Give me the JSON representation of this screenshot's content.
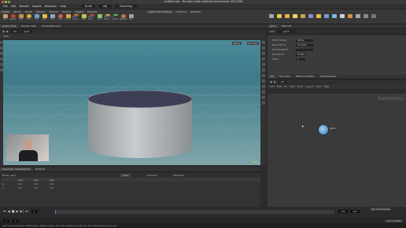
{
  "window": {
    "title": "untitled.hip - Houdini Indie Limited-Commercial 16.5.496"
  },
  "menu": {
    "items": [
      "File",
      "Edit",
      "Render",
      "Assets",
      "Windows",
      "Help"
    ],
    "build_label": "Build",
    "desktop_label": "Modeling",
    "path_label": "obj"
  },
  "shelf": {
    "tabs": [
      "Create",
      "Modify",
      "Model",
      "Polygon",
      "Deform",
      "Texture",
      "Rigging",
      "Muscles"
    ],
    "right_tabs": [
      "Lights and Cameras",
      "Collisions",
      "Particles"
    ],
    "tools": [
      "Box",
      "Sphere",
      "Tube",
      "Torus",
      "Grid",
      "Null",
      "Line",
      "Circle",
      "Curve",
      "Draw Curve",
      "Path",
      "Spray Paint",
      "Font",
      "Platonic Solids",
      "L-System",
      "Metaball",
      "File"
    ]
  },
  "scene_view": {
    "tabs": [
      "Scene View",
      "Render View",
      "Composite View"
    ],
    "path": "obj",
    "node": "geo1",
    "persp_label": "Persp",
    "cam_label": "No cam",
    "hud_label": "Geo"
  },
  "params": {
    "tabs": [
      "geo1",
      "Take List"
    ],
    "node_type": "Geo",
    "node_name": "geo1",
    "fields": [
      {
        "label": "Xform Order",
        "value": "Rotate"
      },
      {
        "label": "Pivot Xform",
        "value": "Translate"
      },
      {
        "label": "Pre-transform",
        "value": ""
      },
      {
        "label": "Transform",
        "value": "Enable"
      },
      {
        "label": "Scale",
        "value": "1"
      }
    ]
  },
  "network": {
    "tabs": [
      "obj",
      "Tree View",
      "Material Palette",
      "Asset Browser"
    ],
    "path": "obj",
    "menu": [
      "Add",
      "Edit",
      "Go",
      "View",
      "Tools",
      "Layout",
      "Labs",
      "Help"
    ],
    "context_label": "Geometry",
    "node_label": "geo1"
  },
  "bottom": {
    "tabs": [
      "Geometry Spreadsheet",
      "Textport"
    ],
    "node_label": "Node: geo1",
    "view_label": "View",
    "intrinsics_label": "Intrinsics",
    "attributes_label": "Attributes",
    "columns": [
      "",
      "P[x]",
      "P[y]",
      "P[z]"
    ],
    "rows": [
      [
        "0",
        "0.0",
        "0.0",
        "0.0"
      ],
      [
        "1",
        "0.0",
        "0.0",
        "0.0"
      ]
    ]
  },
  "timeline": {
    "frame": "1",
    "start": "1",
    "end": "240",
    "range_end": "240",
    "key_all_channels": "Key All Channels",
    "auto_update": "Auto Update"
  },
  "status": {
    "text": "Left mouse tumbles. Middle pans. Right dollies. Ctrl+Alt+Left box-zooms out. Ctrl+Right box-zooms out."
  },
  "colors": {
    "accent": "#e0a040",
    "node": "#6fa8d0",
    "viewport_top": "#4b8a98",
    "viewport_bottom": "#7fa5aa"
  }
}
